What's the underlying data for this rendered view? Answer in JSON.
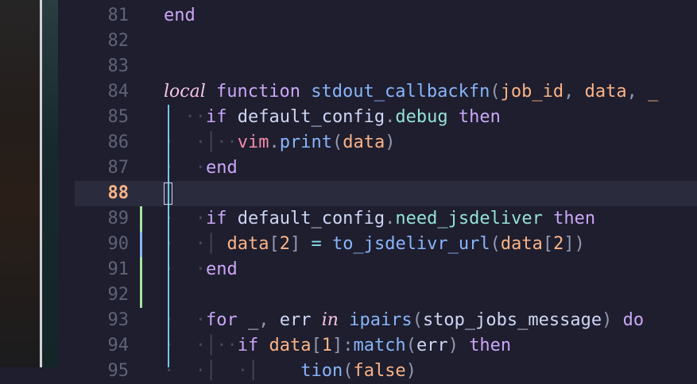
{
  "editor": {
    "cursor_line": "88",
    "lines": [
      {
        "num": "81",
        "tokens": [
          {
            "t": "end",
            "c": "k-purple"
          }
        ]
      },
      {
        "num": "82",
        "tokens": []
      },
      {
        "num": "83",
        "tokens": []
      },
      {
        "num": "84",
        "tokens": [
          {
            "t": "local",
            "c": "k-italic"
          },
          {
            "t": " ",
            "c": "k-text"
          },
          {
            "t": "function",
            "c": "k-purple"
          },
          {
            "t": " ",
            "c": "k-text"
          },
          {
            "t": "stdout_callbackfn",
            "c": "k-blue"
          },
          {
            "t": "(",
            "c": "k-paren"
          },
          {
            "t": "job_id",
            "c": "k-orange"
          },
          {
            "t": ", ",
            "c": "k-paren"
          },
          {
            "t": "data",
            "c": "k-orange"
          },
          {
            "t": ", ",
            "c": "k-paren"
          },
          {
            "t": "_",
            "c": "k-orange"
          }
        ]
      },
      {
        "num": "85",
        "tokens": [
          {
            "t": "  ··",
            "c": "dim"
          },
          {
            "t": "if",
            "c": "k-purple"
          },
          {
            "t": " ",
            "c": "k-text"
          },
          {
            "t": "default_config",
            "c": "k-text"
          },
          {
            "t": ".",
            "c": "k-paren"
          },
          {
            "t": "debug",
            "c": "k-teal"
          },
          {
            "t": " ",
            "c": "k-text"
          },
          {
            "t": "then",
            "c": "k-purple"
          }
        ]
      },
      {
        "num": "86",
        "tokens": [
          {
            "t": "·  ·│··",
            "c": "dim"
          },
          {
            "t": "vim",
            "c": "k-red"
          },
          {
            "t": ".",
            "c": "k-paren"
          },
          {
            "t": "print",
            "c": "k-blue"
          },
          {
            "t": "(",
            "c": "k-paren"
          },
          {
            "t": "data",
            "c": "k-orange"
          },
          {
            "t": ")",
            "c": "k-paren"
          }
        ]
      },
      {
        "num": "87",
        "tokens": [
          {
            "t": "·  ·",
            "c": "dim"
          },
          {
            "t": "end",
            "c": "k-purple"
          }
        ]
      },
      {
        "num": "88",
        "tokens": []
      },
      {
        "num": "89",
        "tokens": [
          {
            "t": "·  ·",
            "c": "dim"
          },
          {
            "t": "if",
            "c": "k-purple"
          },
          {
            "t": " ",
            "c": "k-text"
          },
          {
            "t": "default_config",
            "c": "k-text"
          },
          {
            "t": ".",
            "c": "k-paren"
          },
          {
            "t": "need_jsdeliver",
            "c": "k-teal"
          },
          {
            "t": " ",
            "c": "k-text"
          },
          {
            "t": "then",
            "c": "k-purple"
          }
        ]
      },
      {
        "num": "90",
        "tokens": [
          {
            "t": "·  ·│ ",
            "c": "dim"
          },
          {
            "t": "data",
            "c": "k-orange"
          },
          {
            "t": "[",
            "c": "k-paren"
          },
          {
            "t": "2",
            "c": "k-orange"
          },
          {
            "t": "]",
            "c": "k-paren"
          },
          {
            "t": " ",
            "c": "k-text"
          },
          {
            "t": "=",
            "c": "k-sky"
          },
          {
            "t": " ",
            "c": "k-text"
          },
          {
            "t": "to_jsdelivr_url",
            "c": "k-blue"
          },
          {
            "t": "(",
            "c": "k-paren"
          },
          {
            "t": "data",
            "c": "k-orange"
          },
          {
            "t": "[",
            "c": "k-paren"
          },
          {
            "t": "2",
            "c": "k-orange"
          },
          {
            "t": "])",
            "c": "k-paren"
          }
        ]
      },
      {
        "num": "91",
        "tokens": [
          {
            "t": "·  ·",
            "c": "dim"
          },
          {
            "t": "end",
            "c": "k-purple"
          }
        ]
      },
      {
        "num": "92",
        "tokens": []
      },
      {
        "num": "93",
        "tokens": [
          {
            "t": "·  ·",
            "c": "dim"
          },
          {
            "t": "for",
            "c": "k-purple"
          },
          {
            "t": " ",
            "c": "k-text"
          },
          {
            "t": "_",
            "c": "k-text"
          },
          {
            "t": ", ",
            "c": "k-paren"
          },
          {
            "t": "err",
            "c": "k-text"
          },
          {
            "t": " ",
            "c": "k-text"
          },
          {
            "t": "in",
            "c": "k-italic"
          },
          {
            "t": " ",
            "c": "k-text"
          },
          {
            "t": "ipairs",
            "c": "k-blue"
          },
          {
            "t": "(",
            "c": "k-paren"
          },
          {
            "t": "stop_jobs_message",
            "c": "k-text"
          },
          {
            "t": ")",
            "c": "k-paren"
          },
          {
            "t": " ",
            "c": "k-text"
          },
          {
            "t": "do",
            "c": "k-purple"
          }
        ]
      },
      {
        "num": "94",
        "tokens": [
          {
            "t": "·  ·│··",
            "c": "dim"
          },
          {
            "t": "if",
            "c": "k-purple"
          },
          {
            "t": " ",
            "c": "k-text"
          },
          {
            "t": "data",
            "c": "k-orange"
          },
          {
            "t": "[",
            "c": "k-paren"
          },
          {
            "t": "1",
            "c": "k-orange"
          },
          {
            "t": "]",
            "c": "k-paren"
          },
          {
            "t": ":",
            "c": "k-paren"
          },
          {
            "t": "match",
            "c": "k-blue"
          },
          {
            "t": "(",
            "c": "k-paren"
          },
          {
            "t": "err",
            "c": "k-text"
          },
          {
            "t": ")",
            "c": "k-paren"
          },
          {
            "t": " ",
            "c": "k-text"
          },
          {
            "t": "then",
            "c": "k-purple"
          }
        ]
      },
      {
        "num": "95",
        "tokens": [
          {
            "t": "·  ·│  ·│",
            "c": "dim"
          },
          {
            "t": "  ",
            "c": "k-text"
          },
          {
            "t": "  ",
            "c": "k-text"
          },
          {
            "t": "tion",
            "c": "k-blue"
          },
          {
            "t": "(",
            "c": "k-paren"
          },
          {
            "t": "false",
            "c": "k-orange"
          },
          {
            "t": ")",
            "c": "k-paren"
          }
        ]
      }
    ]
  },
  "gutter": {
    "git_added_color": "#a6e3a1",
    "git_changed_color": "#89b4fa"
  }
}
